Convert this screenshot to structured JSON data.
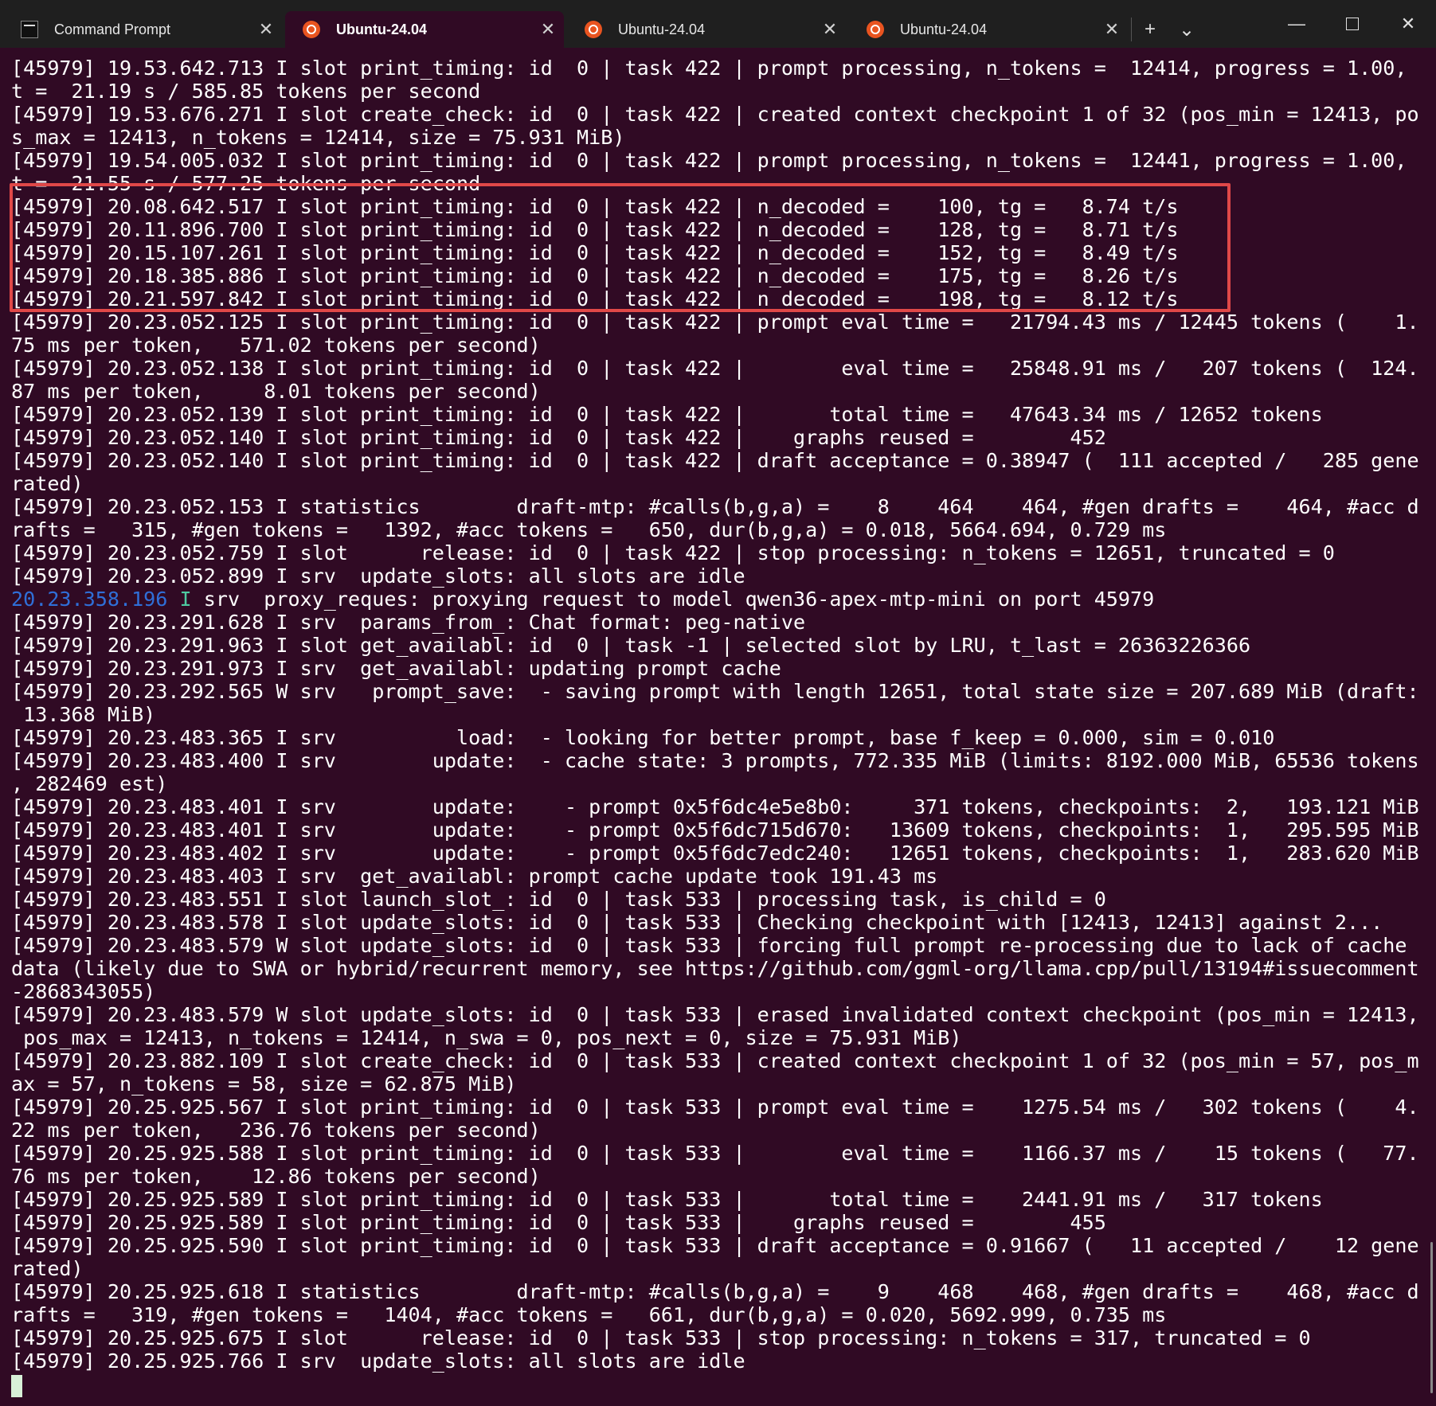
{
  "tabs": [
    {
      "label": "Command Prompt",
      "icon": "command-prompt-icon",
      "active": false
    },
    {
      "label": "Ubuntu-24.04",
      "icon": "ubuntu-icon",
      "active": true
    },
    {
      "label": "Ubuntu-24.04",
      "icon": "ubuntu-icon",
      "active": false
    },
    {
      "label": "Ubuntu-24.04",
      "icon": "ubuntu-icon",
      "active": false
    }
  ],
  "tab_close_glyph": "✕",
  "new_tab_glyph": "+",
  "dropdown_glyph": "⌄",
  "window": {
    "minimize": "—",
    "close": "✕"
  },
  "colors": {
    "background": "#300a24",
    "highlight": "#e04848",
    "timestamp_blue": "#2f6fd8"
  },
  "terminal": {
    "lines": [
      "[45979] 19.53.642.713 I slot print_timing: id  0 | task 422 | prompt processing, n_tokens =  12414, progress = 1.00,",
      "t =  21.19 s / 585.85 tokens per second",
      "[45979] 19.53.676.271 I slot create_check: id  0 | task 422 | created context checkpoint 1 of 32 (pos_min = 12413, po",
      "s_max = 12413, n_tokens = 12414, size = 75.931 MiB)",
      "[45979] 19.54.005.032 I slot print_timing: id  0 | task 422 | prompt processing, n_tokens =  12441, progress = 1.00,",
      "t =  21.55 s / 577.25 tokens per second",
      "[45979] 20.08.642.517 I slot print_timing: id  0 | task 422 | n_decoded =    100, tg =   8.74 t/s",
      "[45979] 20.11.896.700 I slot print_timing: id  0 | task 422 | n_decoded =    128, tg =   8.71 t/s",
      "[45979] 20.15.107.261 I slot print_timing: id  0 | task 422 | n_decoded =    152, tg =   8.49 t/s",
      "[45979] 20.18.385.886 I slot print_timing: id  0 | task 422 | n_decoded =    175, tg =   8.26 t/s",
      "[45979] 20.21.597.842 I slot print_timing: id  0 | task 422 | n_decoded =    198, tg =   8.12 t/s",
      "[45979] 20.23.052.125 I slot print_timing: id  0 | task 422 | prompt eval time =   21794.43 ms / 12445 tokens (    1.",
      "75 ms per token,   571.02 tokens per second)",
      "[45979] 20.23.052.138 I slot print_timing: id  0 | task 422 |        eval time =   25848.91 ms /   207 tokens (  124.",
      "87 ms per token,     8.01 tokens per second)",
      "[45979] 20.23.052.139 I slot print_timing: id  0 | task 422 |       total time =   47643.34 ms / 12652 tokens",
      "[45979] 20.23.052.140 I slot print_timing: id  0 | task 422 |    graphs reused =        452",
      "[45979] 20.23.052.140 I slot print_timing: id  0 | task 422 | draft acceptance = 0.38947 (  111 accepted /   285 gene",
      "rated)",
      "[45979] 20.23.052.153 I statistics        draft-mtp: #calls(b,g,a) =    8    464    464, #gen drafts =    464, #acc d",
      "rafts =   315, #gen tokens =   1392, #acc tokens =   650, dur(b,g,a) = 0.018, 5664.694, 0.729 ms",
      "[45979] 20.23.052.759 I slot      release: id  0 | task 422 | stop processing: n_tokens = 12651, truncated = 0",
      "[45979] 20.23.052.899 I srv  update_slots: all slots are idle",
      "20.23.358.196 I srv  proxy_reques: proxying request to model qwen36-apex-mtp-mini on port 45979",
      "[45979] 20.23.291.628 I srv  params_from_: Chat format: peg-native",
      "[45979] 20.23.291.963 I slot get_availabl: id  0 | task -1 | selected slot by LRU, t_last = 26363226366",
      "[45979] 20.23.291.973 I srv  get_availabl: updating prompt cache",
      "[45979] 20.23.292.565 W srv   prompt_save:  - saving prompt with length 12651, total state size = 207.689 MiB (draft:",
      " 13.368 MiB)",
      "[45979] 20.23.483.365 I srv          load:  - looking for better prompt, base f_keep = 0.000, sim = 0.010",
      "[45979] 20.23.483.400 I srv        update:  - cache state: 3 prompts, 772.335 MiB (limits: 8192.000 MiB, 65536 tokens",
      ", 282469 est)",
      "[45979] 20.23.483.401 I srv        update:    - prompt 0x5f6dc4e5e8b0:     371 tokens, checkpoints:  2,   193.121 MiB",
      "[45979] 20.23.483.401 I srv        update:    - prompt 0x5f6dc715d670:   13609 tokens, checkpoints:  1,   295.595 MiB",
      "[45979] 20.23.483.402 I srv        update:    - prompt 0x5f6dc7edc240:   12651 tokens, checkpoints:  1,   283.620 MiB",
      "[45979] 20.23.483.403 I srv  get_availabl: prompt cache update took 191.43 ms",
      "[45979] 20.23.483.551 I slot launch_slot_: id  0 | task 533 | processing task, is_child = 0",
      "[45979] 20.23.483.578 I slot update_slots: id  0 | task 533 | Checking checkpoint with [12413, 12413] against 2...",
      "[45979] 20.23.483.579 W slot update_slots: id  0 | task 533 | forcing full prompt re-processing due to lack of cache",
      "data (likely due to SWA or hybrid/recurrent memory, see https://github.com/ggml-org/llama.cpp/pull/13194#issuecomment",
      "-2868343055)",
      "[45979] 20.23.483.579 W slot update_slots: id  0 | task 533 | erased invalidated context checkpoint (pos_min = 12413,",
      " pos_max = 12413, n_tokens = 12414, n_swa = 0, pos_next = 0, size = 75.931 MiB)",
      "[45979] 20.23.882.109 I slot create_check: id  0 | task 533 | created context checkpoint 1 of 32 (pos_min = 57, pos_m",
      "ax = 57, n_tokens = 58, size = 62.875 MiB)",
      "[45979] 20.25.925.567 I slot print_timing: id  0 | task 533 | prompt eval time =    1275.54 ms /   302 tokens (    4.",
      "22 ms per token,   236.76 tokens per second)",
      "[45979] 20.25.925.588 I slot print_timing: id  0 | task 533 |        eval time =    1166.37 ms /    15 tokens (   77.",
      "76 ms per token,    12.86 tokens per second)",
      "[45979] 20.25.925.589 I slot print_timing: id  0 | task 533 |       total time =    2441.91 ms /   317 tokens",
      "[45979] 20.25.925.589 I slot print_timing: id  0 | task 533 |    graphs reused =        455",
      "[45979] 20.25.925.590 I slot print_timing: id  0 | task 533 | draft acceptance = 0.91667 (   11 accepted /    12 gene",
      "rated)",
      "[45979] 20.25.925.618 I statistics        draft-mtp: #calls(b,g,a) =    9    468    468, #gen drafts =    468, #acc d",
      "rafts =   319, #gen tokens =   1404, #acc tokens =   661, dur(b,g,a) = 0.020, 5692.999, 0.735 ms",
      "[45979] 20.25.925.675 I slot      release: id  0 | task 533 | stop processing: n_tokens = 317, truncated = 0",
      "[45979] 20.25.925.766 I srv  update_slots: all slots are idle"
    ],
    "proxy_line": {
      "timestamp": "20.23.358.196",
      "level": "I",
      "rest": " srv  proxy_reques: proxying request to model qwen36-apex-mtp-mini on port 45979"
    }
  }
}
